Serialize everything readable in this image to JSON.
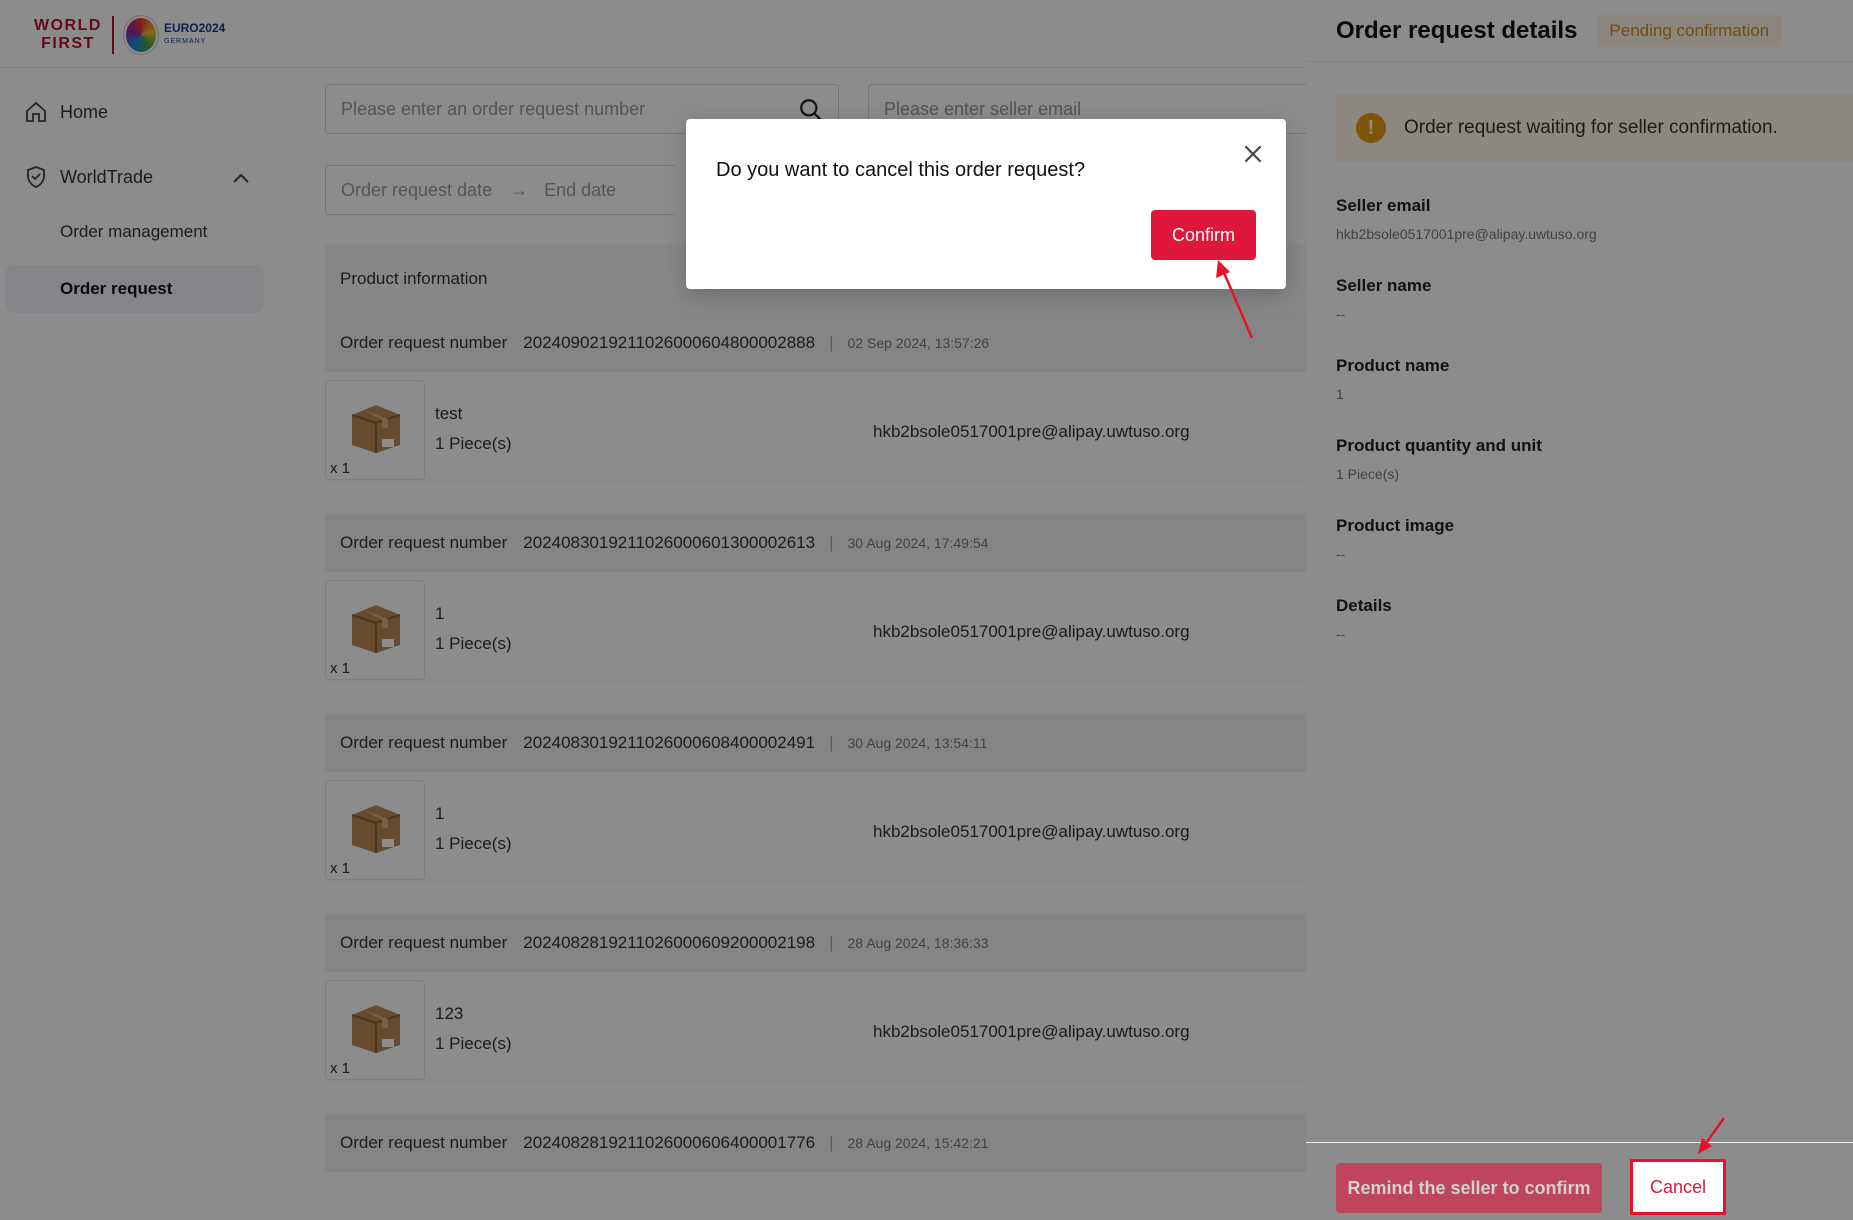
{
  "brand": {
    "logo_line1": "WORLD",
    "logo_line2": "FIRST",
    "partner_text_1": "EURO2024",
    "partner_text_2": "GERMANY",
    "accent_color": "#b8102e"
  },
  "sidebar": {
    "home_label": "Home",
    "worldtrade_label": "WorldTrade",
    "sub_items": [
      {
        "label": "Order management",
        "active": false
      },
      {
        "label": "Order request",
        "active": true
      }
    ]
  },
  "filters": {
    "order_number_placeholder": "Please enter an order request number",
    "seller_email_placeholder": "Please enter seller email",
    "date_start_placeholder": "Order request date",
    "date_arrow": "→",
    "date_end_placeholder": "End date"
  },
  "table": {
    "header_product": "Product information",
    "order_label": "Order request number",
    "orders": [
      {
        "number": "2024090219211026000604800002888",
        "date": "02 Sep 2024, 13:57:26",
        "product": "test",
        "quantity": "1 Piece(s)",
        "qty_badge": "x 1",
        "seller_email": "hkb2bsole0517001pre@alipay.uwtuso.org"
      },
      {
        "number": "2024083019211026000601300002613",
        "date": "30 Aug 2024, 17:49:54",
        "product": "1",
        "quantity": "1 Piece(s)",
        "qty_badge": "x 1",
        "seller_email": "hkb2bsole0517001pre@alipay.uwtuso.org"
      },
      {
        "number": "2024083019211026000608400002491",
        "date": "30 Aug 2024, 13:54:11",
        "product": "1",
        "quantity": "1 Piece(s)",
        "qty_badge": "x 1",
        "seller_email": "hkb2bsole0517001pre@alipay.uwtuso.org"
      },
      {
        "number": "2024082819211026000609200002198",
        "date": "28 Aug 2024, 18:36:33",
        "product": "123",
        "quantity": "1 Piece(s)",
        "qty_badge": "x 1",
        "seller_email": "hkb2bsole0517001pre@alipay.uwtuso.org"
      },
      {
        "number": "2024082819211026000606400001776",
        "date": "28 Aug 2024, 15:42:21"
      }
    ]
  },
  "drawer": {
    "title": "Order request details",
    "status": "Pending confirmation",
    "alert_icon": "!",
    "alert_text": "Order request waiting for seller confirmation.",
    "fields": [
      {
        "label": "Seller email",
        "value": "hkb2bsole0517001pre@alipay.uwtuso.org"
      },
      {
        "label": "Seller name",
        "value": "--"
      },
      {
        "label": "Product name",
        "value": "1"
      },
      {
        "label": "Product quantity and unit",
        "value": "1 Piece(s)"
      },
      {
        "label": "Product image",
        "value": "--"
      },
      {
        "label": "Details",
        "value": "--"
      }
    ],
    "remind_button": "Remind the seller to confirm",
    "cancel_button": "Cancel"
  },
  "modal": {
    "question": "Do you want to cancel this order request?",
    "confirm_button": "Confirm",
    "close_icon": "close-icon"
  },
  "colors": {
    "primary_red": "#e0173c",
    "annotation_red": "#e8122c",
    "warning_orange": "#e89b17"
  }
}
